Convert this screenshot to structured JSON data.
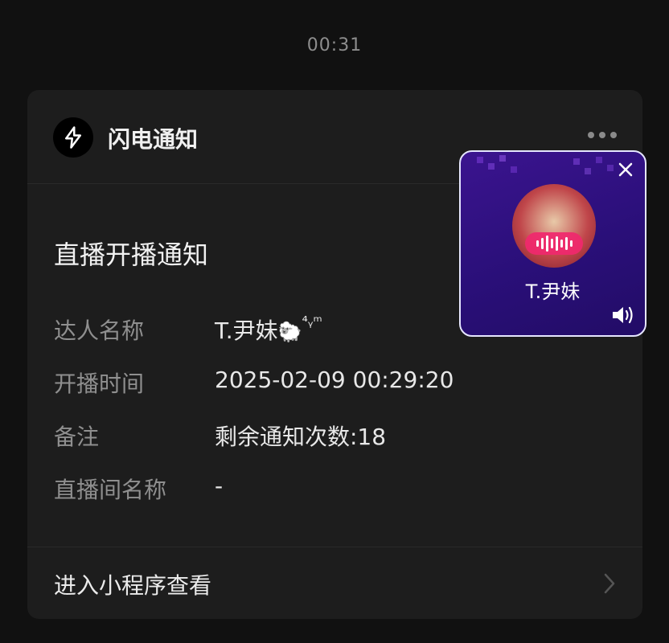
{
  "status_bar": {
    "time": "00:31"
  },
  "card": {
    "app_name": "闪电通知",
    "title": "直播开播通知",
    "rows": [
      {
        "label": "达人名称",
        "value": "T.尹妹",
        "value_suffix": "🐑",
        "value_tail": "⁴ᵧᵐ"
      },
      {
        "label": "开播时间",
        "value": "2025-02-09 00:29:20"
      },
      {
        "label": "备注",
        "value": "剩余通知次数:18"
      },
      {
        "label": "直播间名称",
        "value": "-"
      }
    ],
    "footer_label": "进入小程序查看"
  },
  "floating_player": {
    "name": "T.尹妹",
    "accent_color": "#f0286e",
    "background_color": "#2a0f79"
  }
}
